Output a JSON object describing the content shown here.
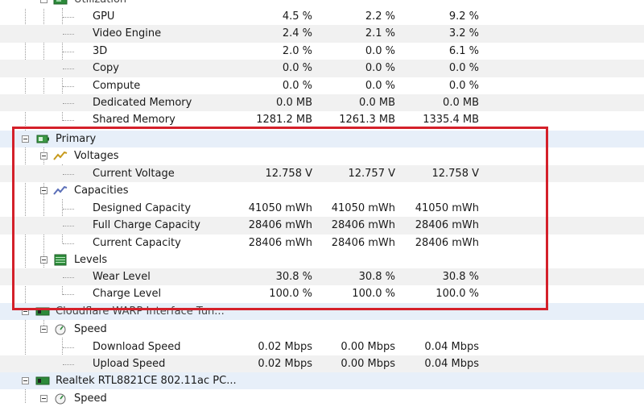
{
  "groups": {
    "utilization": "Utilization",
    "primary": "Primary",
    "voltages": "Voltages",
    "capacities": "Capacities",
    "levels": "Levels",
    "warp": "Cloudflare WARP Interface Tun...",
    "speed": "Speed",
    "realtek": "Realtek RTL8821CE 802.11ac PC...",
    "speed2": "Speed"
  },
  "utilization_rows": [
    {
      "label": "GPU",
      "value": "4.5 %",
      "min": "2.2 %",
      "max": "9.2 %"
    },
    {
      "label": "Video Engine",
      "value": "2.4 %",
      "min": "2.1 %",
      "max": "3.2 %"
    },
    {
      "label": "3D",
      "value": "2.0 %",
      "min": "0.0 %",
      "max": "6.1 %"
    },
    {
      "label": "Copy",
      "value": "0.0 %",
      "min": "0.0 %",
      "max": "0.0 %"
    },
    {
      "label": "Compute",
      "value": "0.0 %",
      "min": "0.0 %",
      "max": "0.0 %"
    },
    {
      "label": "Dedicated Memory",
      "value": "0.0 MB",
      "min": "0.0 MB",
      "max": "0.0 MB"
    },
    {
      "label": "Shared Memory",
      "value": "1281.2 MB",
      "min": "1261.3 MB",
      "max": "1335.4 MB"
    }
  ],
  "voltage_rows": [
    {
      "label": "Current Voltage",
      "value": "12.758 V",
      "min": "12.757 V",
      "max": "12.758 V"
    }
  ],
  "capacity_rows": [
    {
      "label": "Designed Capacity",
      "value": "41050 mWh",
      "min": "41050 mWh",
      "max": "41050 mWh"
    },
    {
      "label": "Full Charge Capacity",
      "value": "28406 mWh",
      "min": "28406 mWh",
      "max": "28406 mWh"
    },
    {
      "label": "Current Capacity",
      "value": "28406 mWh",
      "min": "28406 mWh",
      "max": "28406 mWh"
    }
  ],
  "level_rows": [
    {
      "label": "Wear Level",
      "value": "30.8 %",
      "min": "30.8 %",
      "max": "30.8 %"
    },
    {
      "label": "Charge Level",
      "value": "100.0 %",
      "min": "100.0 %",
      "max": "100.0 %"
    }
  ],
  "speed_rows": [
    {
      "label": "Download Speed",
      "value": "0.02 Mbps",
      "min": "0.00 Mbps",
      "max": "0.04 Mbps"
    },
    {
      "label": "Upload Speed",
      "value": "0.02 Mbps",
      "min": "0.00 Mbps",
      "max": "0.04 Mbps"
    }
  ],
  "colors": {
    "highlight": "#d4202a",
    "group_row": "#e7eff9",
    "alt_row": "#f1f1f1"
  }
}
